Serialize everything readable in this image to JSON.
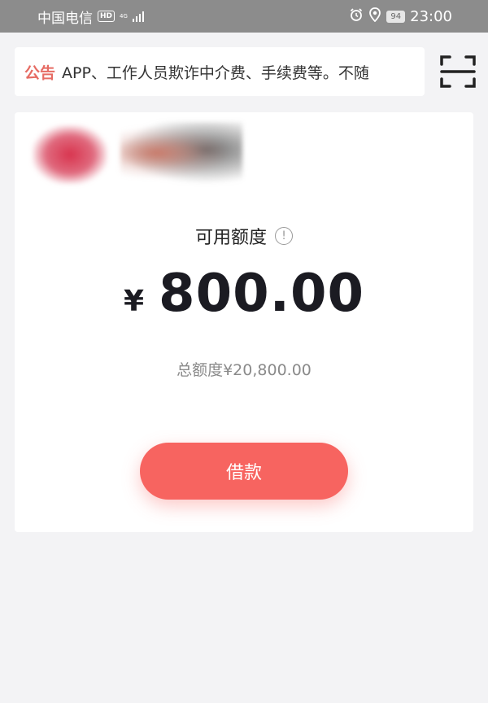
{
  "status_bar": {
    "carrier": "中国电信",
    "hd_badge": "HD",
    "network": "4G",
    "battery": "94",
    "time": "23:00"
  },
  "notice": {
    "tag": "公告",
    "text": "APP、工作人员欺诈中介费、手续费等。不随"
  },
  "card": {
    "credit_label": "可用额度",
    "currency_symbol": "¥",
    "available_amount": "800.00",
    "total_label": "总额度¥20,800.00",
    "borrow_button": "借款"
  },
  "colors": {
    "accent": "#f76460",
    "notice_tag": "#e66b63",
    "status_bar": "#8c8c8c",
    "background": "#f3f3f5"
  },
  "icons": [
    "alarm-icon",
    "location-icon",
    "scan-icon",
    "info-icon",
    "signal-icon",
    "battery-icon"
  ]
}
